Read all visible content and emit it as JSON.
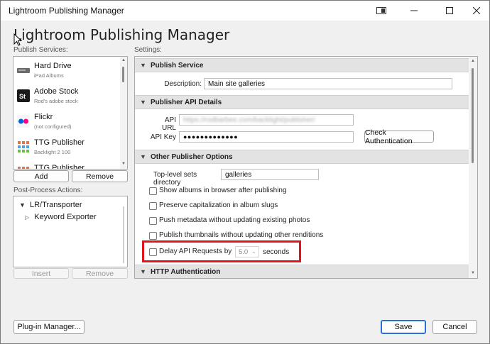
{
  "window": {
    "title": "Lightroom Publishing Manager"
  },
  "heading": "Lightroom Publishing Manager",
  "publish_services": {
    "label": "Publish Services:",
    "items": [
      {
        "name": "Hard Drive",
        "sub": "iPad Albums",
        "icon": "hard-drive-icon"
      },
      {
        "name": "Adobe Stock",
        "sub": "Rod's adobe stock",
        "icon": "adobe-stock-icon"
      },
      {
        "name": "Flickr",
        "sub": "(not configured)",
        "icon": "flickr-icon"
      },
      {
        "name": "TTG Publisher",
        "sub": "Backlight 2 100",
        "icon": "ttg-publisher-icon"
      },
      {
        "name": "TTG Publisher",
        "sub": "",
        "icon": "ttg-publisher-icon"
      }
    ],
    "add_label": "Add",
    "remove_label": "Remove"
  },
  "post_process": {
    "label": "Post-Process Actions:",
    "tree": [
      {
        "label": "LR/Transporter",
        "expanded": true
      },
      {
        "label": "Keyword Exporter",
        "expanded": false
      }
    ],
    "insert_label": "Insert",
    "remove_label": "Remove"
  },
  "settings": {
    "label": "Settings:",
    "publish_service": {
      "header": "Publish Service",
      "description_label": "Description:",
      "description_value": "Main site galleries"
    },
    "publisher_api": {
      "header": "Publisher API Details",
      "url_label": "API URL",
      "url_value": "https://rodbarbee.com/backlight/publisher/",
      "key_label": "API Key",
      "key_value": "●●●●●●●●●●●●●",
      "check_auth_label": "Check Authentication"
    },
    "other_options": {
      "header": "Other Publisher Options",
      "top_level_label": "Top-level sets directory",
      "top_level_value": "galleries",
      "checkboxes": [
        "Show albums in browser after publishing",
        "Preserve capitalization in album slugs",
        "Push metadata without updating existing photos",
        "Publish thumbnails without updating other renditions"
      ],
      "delay_label": "Delay API Requests by",
      "delay_value": "5.0",
      "delay_unit": "seconds"
    },
    "http_auth": {
      "header": "HTTP Authentication"
    }
  },
  "footer": {
    "plugin_manager_label": "Plug-in Manager...",
    "save_label": "Save",
    "cancel_label": "Cancel"
  },
  "colors": {
    "highlight": "#e1141d",
    "primary_border": "#2a6fd6"
  }
}
